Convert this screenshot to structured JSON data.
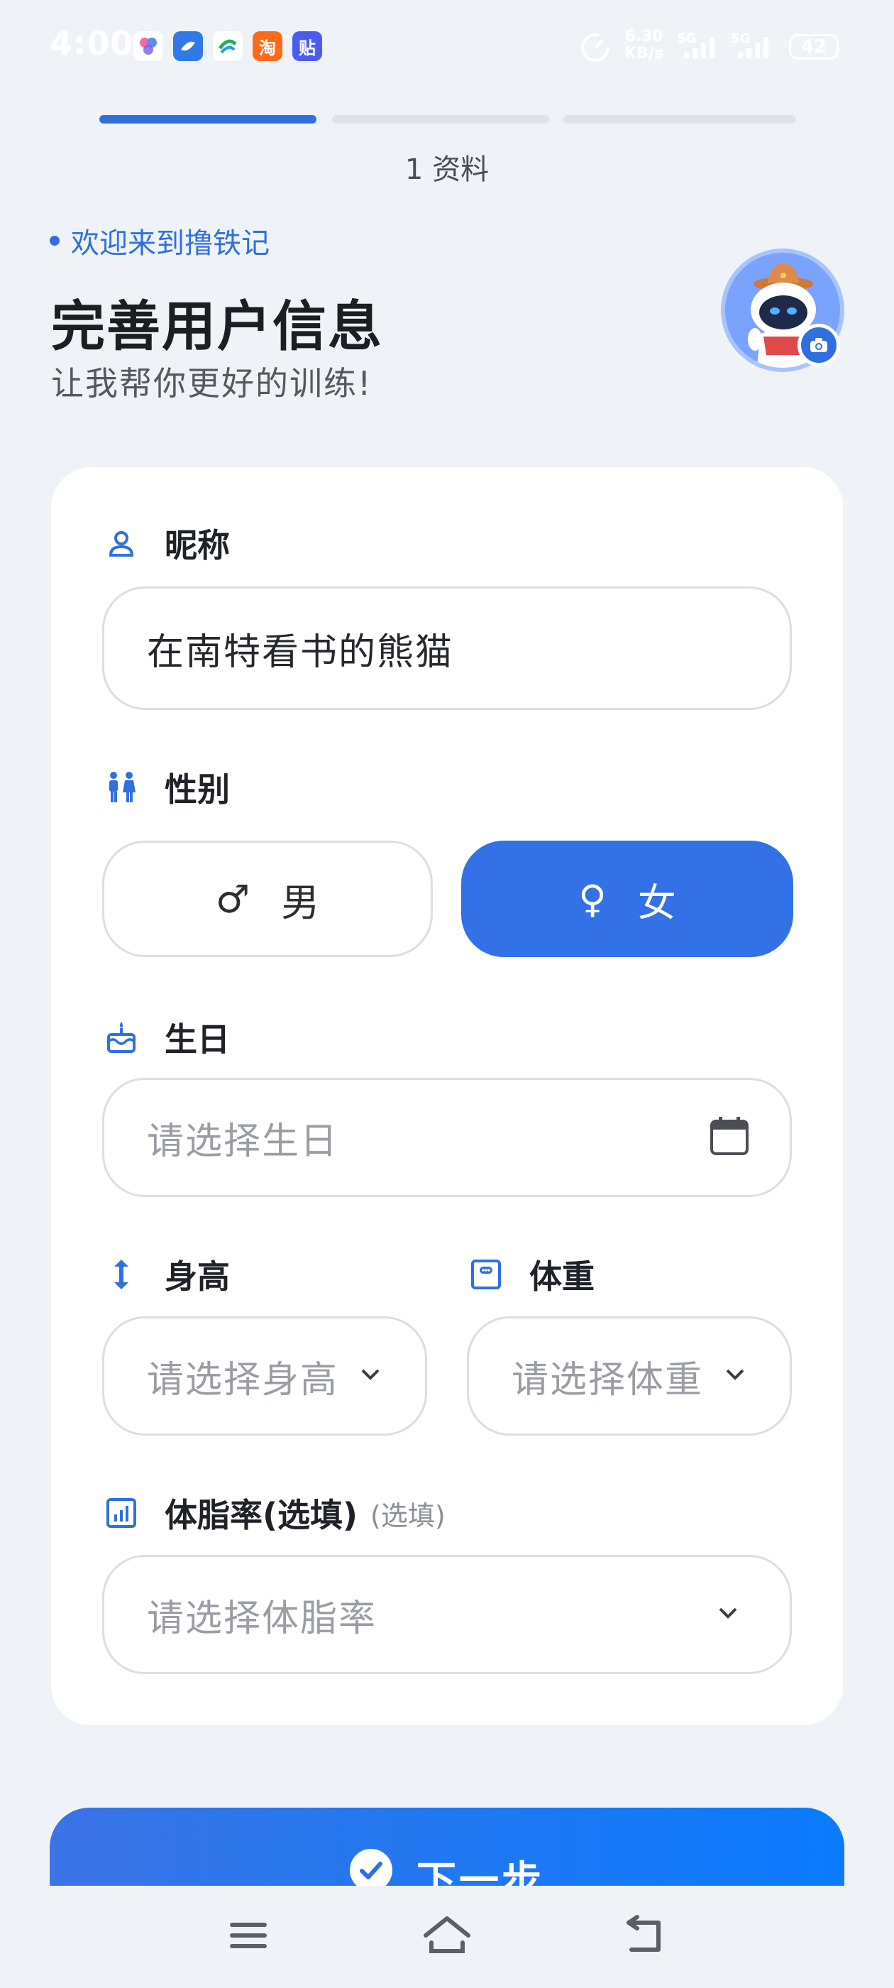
{
  "status_bar": {
    "time": "4:00",
    "app_icons": [
      "app-icon-1",
      "app-icon-2",
      "china-mobile-icon",
      "taobao-icon",
      "tieba-icon"
    ],
    "taobao_char": "淘",
    "tieba_char": "贴",
    "net_speed_value": "6.30",
    "net_speed_unit": "KB/s",
    "signal_label_1": "5G",
    "signal_label_2": "5G",
    "battery": "42"
  },
  "progress": {
    "steps": 3,
    "active_step": 1,
    "step_label": "1 资料"
  },
  "header": {
    "welcome": "欢迎来到撸铁记",
    "title": "完善用户信息",
    "subtitle": "让我帮你更好的训练!"
  },
  "form": {
    "nickname": {
      "label": "昵称",
      "value": "在南特看书的熊猫"
    },
    "gender": {
      "label": "性别",
      "male": "男",
      "female": "女",
      "male_symbol": "♂",
      "female_symbol": "♀",
      "selected": "female"
    },
    "birthday": {
      "label": "生日",
      "placeholder": "请选择生日"
    },
    "height": {
      "label": "身高",
      "placeholder": "请选择身高"
    },
    "weight": {
      "label": "体重",
      "placeholder": "请选择体重"
    },
    "body_fat": {
      "label": "体脂率(选填)",
      "optional": "(选填)",
      "placeholder": "请选择体脂率"
    }
  },
  "next_button": {
    "label": "下一步"
  },
  "colors": {
    "accent": "#2f6fe0",
    "background": "#eff3f8",
    "card": "#ffffff"
  }
}
